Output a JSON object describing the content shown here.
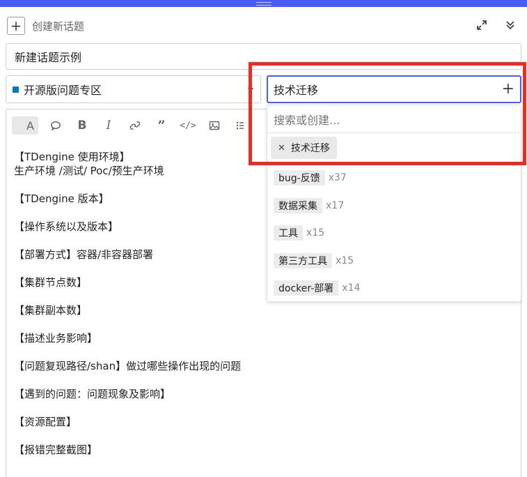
{
  "header": {
    "title": "创建新话题"
  },
  "title_input": {
    "value": "新建话题示例"
  },
  "category": {
    "label": "开源版问题专区",
    "color": "#0e76bd"
  },
  "tag_input": {
    "value": "技术迁移"
  },
  "dropdown": {
    "search_placeholder": "搜索或创建...",
    "selected_tag": "技术迁移",
    "options": [
      {
        "label": "bug-反馈",
        "count": "x37"
      },
      {
        "label": "数据采集",
        "count": "x17"
      },
      {
        "label": "工具",
        "count": "x15"
      },
      {
        "label": "第三方工具",
        "count": "x15"
      },
      {
        "label": "docker-部署",
        "count": "x14"
      }
    ]
  },
  "toolbar": {
    "active_label": "A",
    "bold_label": "B",
    "italic_label": "I",
    "quote_label": "”",
    "code_label": "</>"
  },
  "editor": {
    "lines": [
      "【TDengine 使用环境】",
      "生产环境 /测试/ Poc/预生产环境",
      "【TDengine 版本】",
      "【操作系统以及版本】",
      "【部署方式】容器/非容器部署",
      "【集群节点数】",
      "【集群副本数】",
      "【描述业务影响】",
      "【问题复现路径/shan】做过哪些操作出现的问题",
      "【遇到的问题：问题现象及影响】",
      "【资源配置】",
      "【报错完整截图】"
    ]
  },
  "colors": {
    "accent": "#4a5cf2",
    "highlight": "#ee2a22"
  }
}
